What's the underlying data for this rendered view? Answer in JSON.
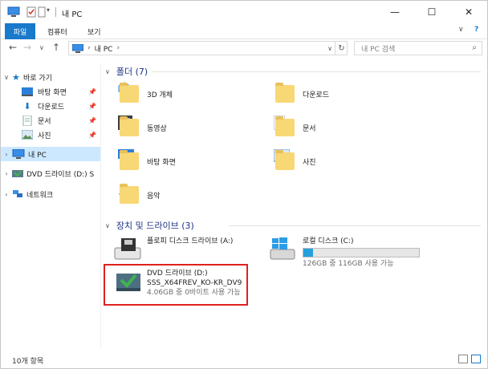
{
  "window": {
    "title": "내 PC",
    "controls": {
      "minimize": "—",
      "maximize": "☐",
      "close": "✕"
    }
  },
  "ribbon": {
    "tabs": [
      "파일",
      "컴퓨터",
      "보기"
    ],
    "collapse": "∨",
    "help": "?"
  },
  "address": {
    "back": "←",
    "forward": "→",
    "recent": "∨",
    "up": "↑",
    "crumbs": [
      "내 PC"
    ],
    "search_placeholder": "내 PC 검색"
  },
  "sidebar": {
    "quick_access": "바로 가기",
    "quick_items": [
      "바탕 화면",
      "다운로드",
      "문서",
      "사진"
    ],
    "this_pc": "내 PC",
    "dvd": "DVD 드라이브 (D:) S",
    "network": "네트워크"
  },
  "main": {
    "folders_header": "폴더 (7)",
    "folders": [
      "3D 개체",
      "다운로드",
      "동영상",
      "문서",
      "바탕 화면",
      "사진",
      "음악"
    ],
    "drives_header": "장치 및 드라이브 (3)",
    "drives": [
      {
        "name": "플로피 디스크 드라이브 (A:)"
      },
      {
        "name": "로컬 디스크 (C:)",
        "free": "126GB 중 116GB 사용 가능",
        "used_fraction": 0.08
      },
      {
        "name": "DVD 드라이브 (D:)",
        "label": "SSS_X64FREV_KO-KR_DV9",
        "free": "4.06GB 중 0바이트 사용 가능"
      }
    ]
  },
  "status": {
    "items": "10개 항목"
  },
  "colors": {
    "accent": "#1979ca",
    "selected": "#cce8ff",
    "highlight": "#e02020",
    "bar": "#26a0da"
  }
}
